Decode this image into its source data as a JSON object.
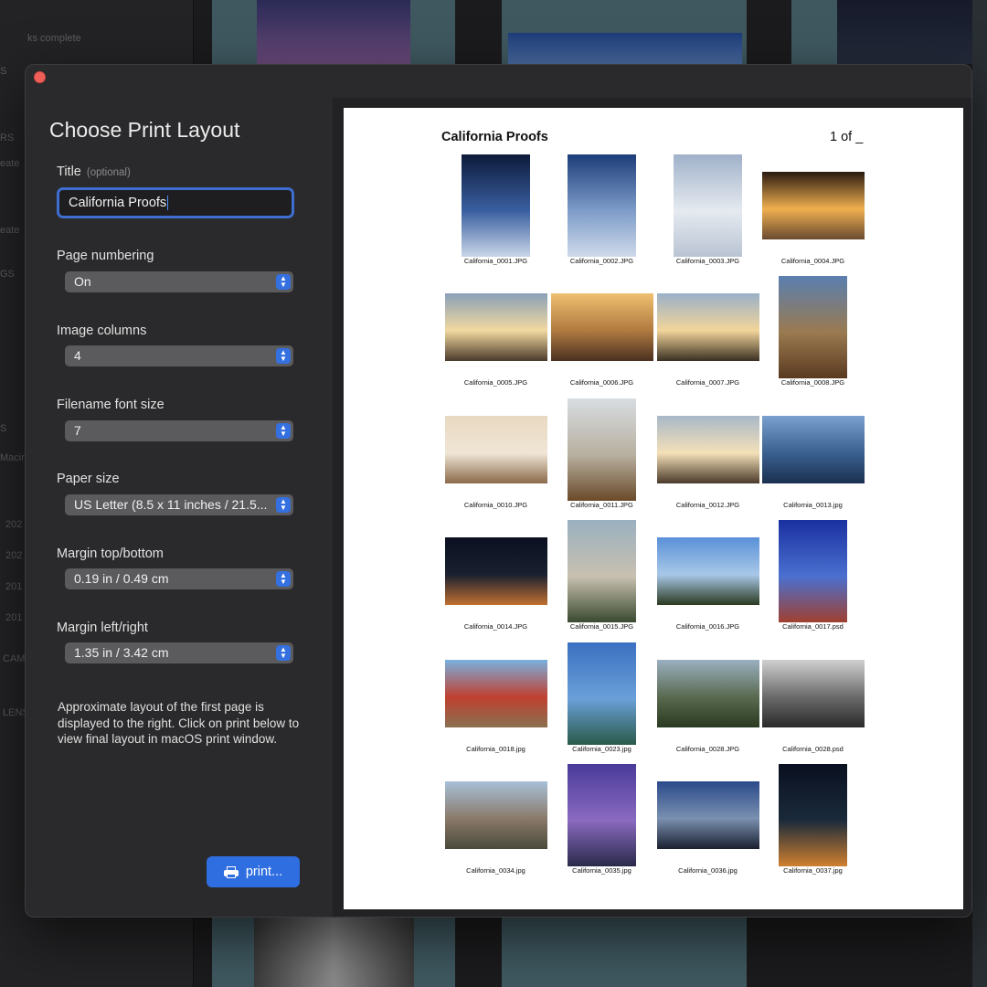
{
  "background": {
    "sidebar_fragments": [
      "ks complete",
      "S",
      "RS",
      "eate",
      "eate",
      "GS",
      "S",
      "Macin",
      "202",
      "202",
      "201",
      "201",
      "CAM",
      "LENS"
    ]
  },
  "dialog": {
    "title": "Choose Print Layout",
    "title_field": {
      "label": "Title",
      "optional": "(optional)",
      "value": "California Proofs"
    },
    "page_numbering": {
      "label": "Page numbering",
      "value": "On"
    },
    "image_columns": {
      "label": "Image columns",
      "value": "4"
    },
    "filename_font_size": {
      "label": "Filename font size",
      "value": "7"
    },
    "paper_size": {
      "label": "Paper size",
      "value": "US Letter  (8.5 x 11 inches / 21.5..."
    },
    "margin_tb": {
      "label": "Margin top/bottom",
      "value": "0.19 in / 0.49 cm"
    },
    "margin_lr": {
      "label": "Margin left/right",
      "value": "1.35 in / 3.42 cm"
    },
    "info": "Approximate layout of the first page is displayed to the right. Click on print below to view final layout in macOS print window.",
    "print_label": "print..."
  },
  "preview": {
    "title": "California Proofs",
    "page_number": "1 of _",
    "images": [
      {
        "name": "California_0001.JPG",
        "orient": "portrait",
        "colors": [
          "#0d1a3a",
          "#3a5fa0",
          "#c9d6e8"
        ]
      },
      {
        "name": "California_0002.JPG",
        "orient": "portrait",
        "colors": [
          "#1d3d7a",
          "#7d9cc8",
          "#cfdaea"
        ]
      },
      {
        "name": "California_0003.JPG",
        "orient": "portrait",
        "colors": [
          "#9fb1c9",
          "#e6eaf0",
          "#b9c4d3"
        ]
      },
      {
        "name": "California_0004.JPG",
        "orient": "landscape",
        "colors": [
          "#2a1a10",
          "#f0b050",
          "#6a4a30"
        ]
      },
      {
        "name": "California_0005.JPG",
        "orient": "landscape",
        "colors": [
          "#8aa0b8",
          "#f2d9a0",
          "#4a3a2a"
        ]
      },
      {
        "name": "California_0006.JPG",
        "orient": "landscape",
        "colors": [
          "#f0c070",
          "#b07a40",
          "#4a3020"
        ]
      },
      {
        "name": "California_0007.JPG",
        "orient": "landscape",
        "colors": [
          "#9ab0c8",
          "#f3d59a",
          "#3a3022"
        ]
      },
      {
        "name": "California_0008.JPG",
        "orient": "portrait",
        "colors": [
          "#5a7fb0",
          "#9a7a50",
          "#5a3a20"
        ]
      },
      {
        "name": "California_0010.JPG",
        "orient": "landscape",
        "colors": [
          "#e8d8c0",
          "#f0e6d6",
          "#8a6a4a"
        ]
      },
      {
        "name": "California_0011.JPG",
        "orient": "portrait",
        "colors": [
          "#d8dde2",
          "#b8b0a0",
          "#6a4a2a"
        ]
      },
      {
        "name": "California_0012.JPG",
        "orient": "landscape",
        "colors": [
          "#a8b8c8",
          "#f4e0b8",
          "#4a3a2a"
        ]
      },
      {
        "name": "California_0013.jpg",
        "orient": "landscape",
        "colors": [
          "#7aa0d0",
          "#3a6090",
          "#1a3050"
        ]
      },
      {
        "name": "California_0014.JPG",
        "orient": "landscape",
        "colors": [
          "#0a1020",
          "#1a2030",
          "#c07030"
        ]
      },
      {
        "name": "California_0015.JPG",
        "orient": "portrait",
        "colors": [
          "#9ab0c0",
          "#c8c0b0",
          "#3a4a30"
        ]
      },
      {
        "name": "California_0016.JPG",
        "orient": "landscape",
        "colors": [
          "#5a90d8",
          "#a8c8e8",
          "#2a3a20"
        ]
      },
      {
        "name": "California_0017.psd",
        "orient": "portrait",
        "colors": [
          "#1a30a0",
          "#4a70d0",
          "#a04030"
        ]
      },
      {
        "name": "California_0018.jpg",
        "orient": "landscape",
        "colors": [
          "#7ab0e0",
          "#c04030",
          "#8a7050"
        ]
      },
      {
        "name": "California_0023.jpg",
        "orient": "portrait",
        "colors": [
          "#3a70c0",
          "#6aa0d8",
          "#2a5a4a"
        ]
      },
      {
        "name": "California_0028.JPG",
        "orient": "landscape",
        "colors": [
          "#9ab0c0",
          "#5a6a50",
          "#2a3a20"
        ]
      },
      {
        "name": "California_0028.psd",
        "orient": "landscape",
        "colors": [
          "#d0d0d0",
          "#6a6a6a",
          "#2a2a2a"
        ]
      },
      {
        "name": "California_0034.jpg",
        "orient": "landscape",
        "colors": [
          "#a8c0d8",
          "#8a7a6a",
          "#4a4a3a"
        ]
      },
      {
        "name": "California_0035.jpg",
        "orient": "portrait",
        "colors": [
          "#4a3a9a",
          "#8a6ac0",
          "#2a2a4a"
        ]
      },
      {
        "name": "California_0036.jpg",
        "orient": "landscape",
        "colors": [
          "#2a4a8a",
          "#7a90b0",
          "#1a2030"
        ]
      },
      {
        "name": "California_0037.jpg",
        "orient": "portrait",
        "colors": [
          "#0a1020",
          "#1a2a3a",
          "#d08030"
        ]
      }
    ]
  }
}
